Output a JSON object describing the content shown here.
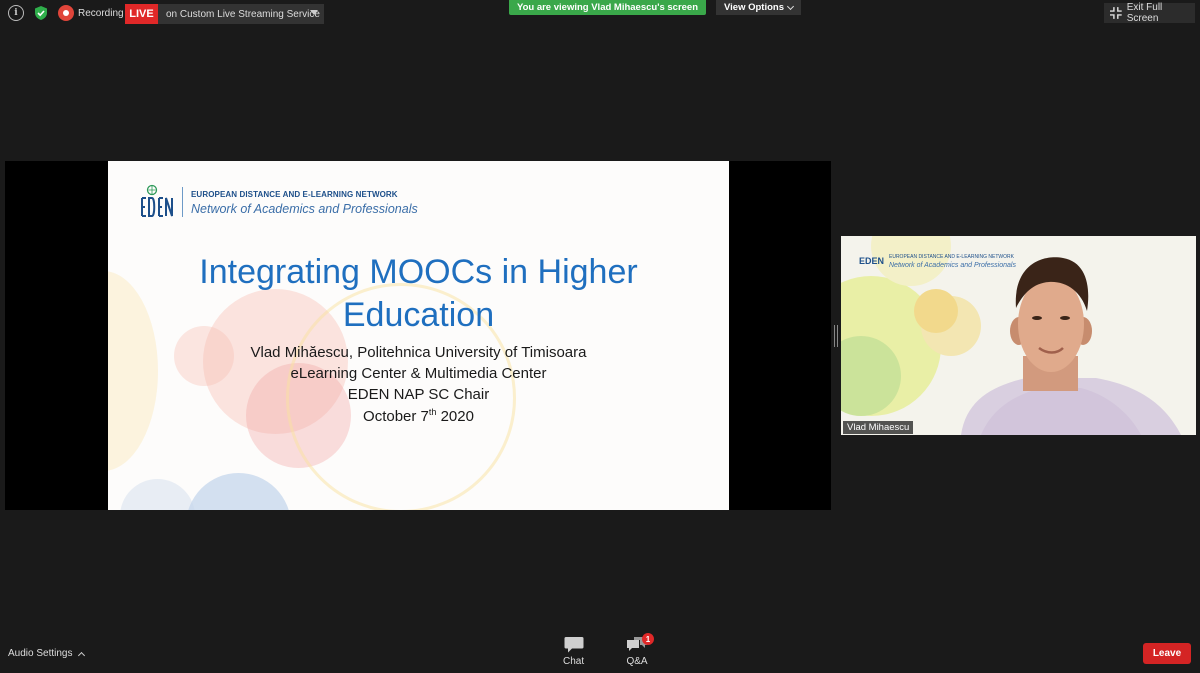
{
  "topbar": {
    "recording_label": "Recording",
    "live_label": "LIVE",
    "stream_service": "on Custom Live Streaming Service",
    "viewing_banner": "You are viewing Vlad Mihaescu's screen",
    "view_options": "View Options",
    "exit_fullscreen": "Exit Full Screen"
  },
  "slide": {
    "logo_text": "EDEN",
    "org_line1": "EUROPEAN DISTANCE AND E-LEARNING NETWORK",
    "org_line2": "Network of Academics and Professionals",
    "title_line1": "Integrating MOOCs in Higher",
    "title_line2": "Education",
    "subtitle1": "Vlad Mihăescu, Politehnica University of Timisoara",
    "subtitle2": "eLearning Center & Multimedia Center",
    "subtitle3": "EDEN NAP SC Chair",
    "date_prefix": "October 7",
    "date_sup": "th",
    "date_suffix": " 2020"
  },
  "video": {
    "participant_name": "Vlad Mihaescu"
  },
  "bottombar": {
    "audio_settings": "Audio Settings",
    "chat_label": "Chat",
    "qa_label": "Q&A",
    "qa_badge": "1",
    "leave_label": "Leave"
  },
  "colors": {
    "live_red": "#e02828",
    "banner_green": "#3aa84a",
    "title_blue": "#1f6fbf",
    "leave_red": "#d42424"
  }
}
